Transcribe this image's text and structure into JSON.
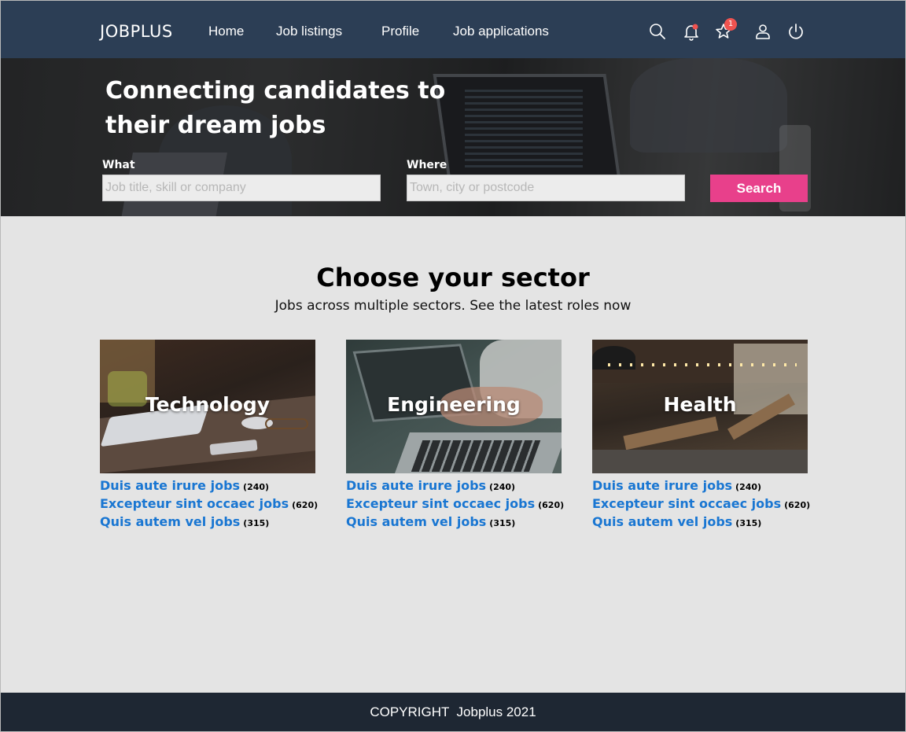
{
  "header": {
    "brand": "JOBPLUS",
    "nav": [
      "Home",
      "Job listings",
      "Profile",
      "Job applications"
    ],
    "favorites_badge": "1",
    "icons": [
      "search-icon",
      "bell-icon",
      "star-icon",
      "user-icon",
      "power-icon"
    ]
  },
  "hero": {
    "title": "Connecting candidates to their dream jobs",
    "what_label": "What",
    "what_placeholder": "Job title, skill or company",
    "where_label": "Where",
    "where_placeholder": "Town, city or postcode",
    "search_label": "Search"
  },
  "sectors": {
    "title": "Choose your sector",
    "subtitle": "Jobs across multiple sectors. See the latest roles now",
    "cards": [
      {
        "label": "Technology",
        "links": [
          {
            "text": "Duis aute irure jobs",
            "count": "(240)"
          },
          {
            "text": "Excepteur sint occaec jobs",
            "count": "(620)"
          },
          {
            "text": "Quis autem vel  jobs",
            "count": "(315)"
          }
        ]
      },
      {
        "label": "Engineering",
        "links": [
          {
            "text": "Duis aute irure jobs",
            "count": "(240)"
          },
          {
            "text": "Excepteur sint occaec jobs",
            "count": "(620)"
          },
          {
            "text": "Quis autem vel  jobs",
            "count": "(315)"
          }
        ]
      },
      {
        "label": "Health",
        "links": [
          {
            "text": "Duis aute irure jobs",
            "count": "(240)"
          },
          {
            "text": "Excepteur sint occaec jobs",
            "count": "(620)"
          },
          {
            "text": "Quis autem vel  jobs",
            "count": "(315)"
          }
        ]
      }
    ]
  },
  "footer": {
    "text": "COPYRIGHT  Jobplus 2021"
  },
  "colors": {
    "header_bg": "#2c3e55",
    "accent": "#e8408b",
    "link": "#1976d2",
    "footer_bg": "#1e2733",
    "page_bg": "#e4e4e4"
  }
}
